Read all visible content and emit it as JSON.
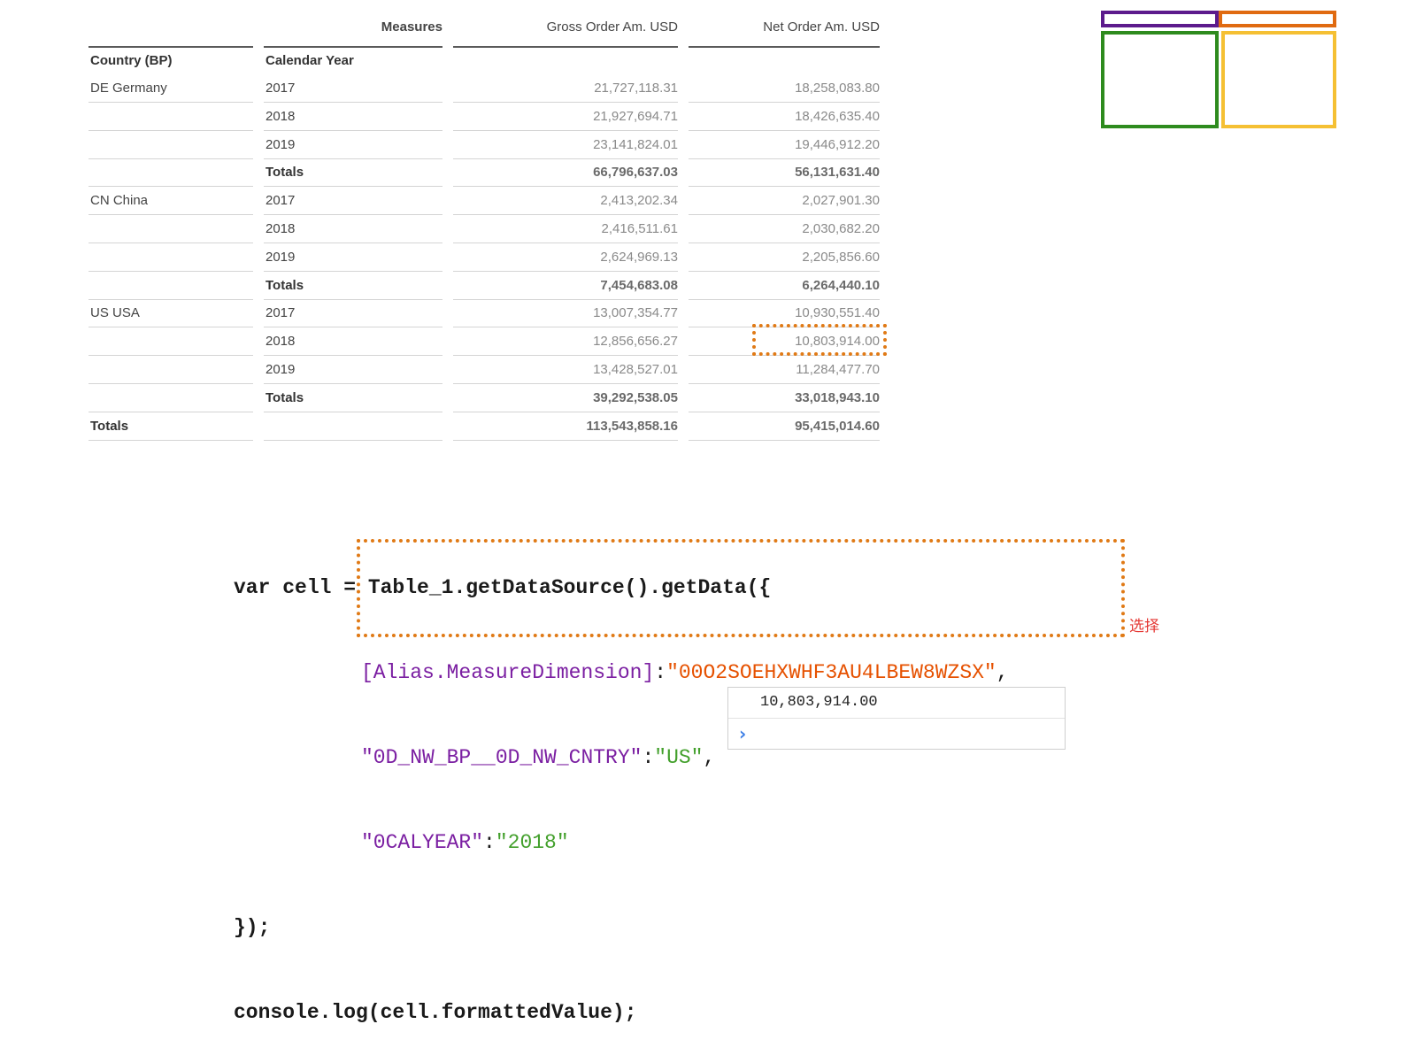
{
  "table": {
    "measures_label": "Measures",
    "col_country": "Country (BP)",
    "col_year": "Calendar Year",
    "col_gross": "Gross Order Am. USD",
    "col_net": "Net Order Am. USD",
    "rows": [
      {
        "country": "DE Germany",
        "year": "2017",
        "gross": "21,727,118.31",
        "net": "18,258,083.80"
      },
      {
        "country": "",
        "year": "2018",
        "gross": "21,927,694.71",
        "net": "18,426,635.40"
      },
      {
        "country": "",
        "year": "2019",
        "gross": "23,141,824.01",
        "net": "19,446,912.20"
      },
      {
        "country": "",
        "year": "Totals",
        "gross": "66,796,637.03",
        "net": "56,131,631.40"
      },
      {
        "country": "CN China",
        "year": "2017",
        "gross": "2,413,202.34",
        "net": "2,027,901.30"
      },
      {
        "country": "",
        "year": "2018",
        "gross": "2,416,511.61",
        "net": "2,030,682.20"
      },
      {
        "country": "",
        "year": "2019",
        "gross": "2,624,969.13",
        "net": "2,205,856.60"
      },
      {
        "country": "",
        "year": "Totals",
        "gross": "7,454,683.08",
        "net": "6,264,440.10"
      },
      {
        "country": "US USA",
        "year": "2017",
        "gross": "13,007,354.77",
        "net": "10,930,551.40"
      },
      {
        "country": "",
        "year": "2018",
        "gross": "12,856,656.27",
        "net": "10,803,914.00"
      },
      {
        "country": "",
        "year": "2019",
        "gross": "13,428,527.01",
        "net": "11,284,477.70"
      },
      {
        "country": "",
        "year": "Totals",
        "gross": "39,292,538.05",
        "net": "33,018,943.10"
      },
      {
        "country": "Totals",
        "year": "",
        "gross": "113,543,858.16",
        "net": "95,415,014.60"
      }
    ]
  },
  "layout_colors": {
    "top_left": "#5c1a8c",
    "top_right": "#e06a10",
    "bottom_left": "#2e8b1e",
    "bottom_right": "#f5c033"
  },
  "code": {
    "line1": "var cell = Table_1.getDataSource().getData({",
    "key1": "[Alias.MeasureDimension]",
    "val1": "\"00O2SOEHXWHF3AU4LBEW8WZSX\"",
    "key2": "\"0D_NW_BP__0D_NW_CNTRY\"",
    "val2": "\"US\"",
    "key3": "\"0CALYEAR\"",
    "val3": "\"2018\"",
    "line5": "});",
    "line6": "console.log(cell.formattedValue);",
    "colon": ":",
    "comma": ","
  },
  "select_label": "选择",
  "console": {
    "output": "10,803,914.00",
    "prompt": "›"
  }
}
